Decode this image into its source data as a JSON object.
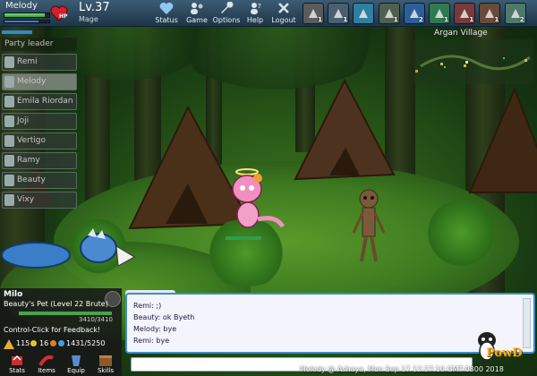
{
  "character": {
    "name": "Melody",
    "level": "Lv.37",
    "class": "Mage",
    "hp_label": "HP",
    "hp_fraction": 0.9,
    "mp_fraction": 0.75
  },
  "menu": [
    {
      "label": "Status",
      "icon": "heart-icon"
    },
    {
      "label": "Game",
      "icon": "game-people-icon"
    },
    {
      "label": "Options",
      "icon": "wrench-icon"
    },
    {
      "label": "Help",
      "icon": "help-person-icon"
    },
    {
      "label": "Logout",
      "icon": "close-icon"
    }
  ],
  "skills": [
    {
      "num": "1",
      "color": "#5b5b5b"
    },
    {
      "num": "1",
      "color": "#4a6070"
    },
    {
      "num": "",
      "color": "#2f7fa0"
    },
    {
      "num": "1",
      "color": "#4f6050"
    },
    {
      "num": "2",
      "color": "#2b5f9a"
    },
    {
      "num": "1",
      "color": "#2f7a4f"
    },
    {
      "num": "1",
      "color": "#7a3a3a"
    },
    {
      "num": "1",
      "color": "#6a4a3a"
    },
    {
      "num": "2",
      "color": "#4f7a6a"
    }
  ],
  "party": {
    "title": "Party leader",
    "members": [
      "Remi",
      "Melody",
      "Emila Riordan",
      "Joji",
      "Vertigo",
      "Ramy",
      "Beauty",
      "Vixy"
    ],
    "selected_index": 1
  },
  "map": {
    "title": "Argan Village"
  },
  "pet": {
    "name": "Milo",
    "description": "Beauty's Pet (Level 22 Brute)",
    "hp_text": "3410/3410",
    "hp_fraction": 1.0,
    "feedback": "Control-Click for Feedback!",
    "gold": "115",
    "gems": "16",
    "xp": "1431/5250",
    "buttons": [
      {
        "label": "Stats",
        "icon": "stats-icon"
      },
      {
        "label": "Items",
        "icon": "items-icon"
      },
      {
        "label": "Equip",
        "icon": "equip-icon"
      },
      {
        "label": "Skills",
        "icon": "skills-book-icon"
      }
    ]
  },
  "chat": {
    "lines": [
      "Remi: ;)",
      "Beauty: ok Byeth",
      "Melody: bye",
      "Remi: bye"
    ]
  },
  "status_line": "Melody @ Ashaya, Mon Sep 17 12:27:10 GMT-0800 2018",
  "logo_text": "PowD",
  "colors": {
    "accent_blue": "#3d8ec8",
    "topbar": "#2c4a60"
  }
}
